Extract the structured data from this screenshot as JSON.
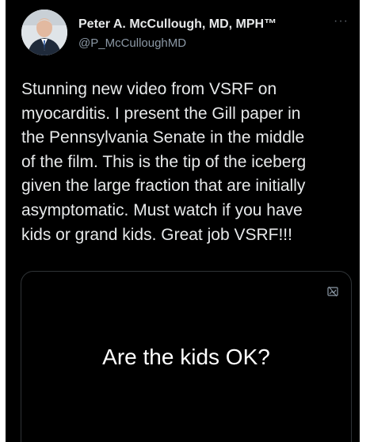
{
  "author": {
    "display_name": "Peter A. McCullough, MD, MPH™",
    "handle": "@P_McCulloughMD"
  },
  "tweet": {
    "text": "Stunning new video from VSRF on\nmyocarditis.  I present the Gill paper in\nthe Pennsylvania Senate in the middle\nof the film.  This is the tip of the iceberg\ngiven the large fraction that are initially\nasymptomatic.  Must watch if you have\nkids or grand kids.  Great job VSRF!!!"
  },
  "media": {
    "title": "Are the kids OK?",
    "icon": "broken-image-icon"
  },
  "menu": {
    "icon": "more-options-icon",
    "glyph": "···"
  },
  "colors": {
    "background": "#000000",
    "text_primary": "#e7e9ea",
    "text_secondary": "#8b98a5",
    "border": "#2f3336"
  }
}
